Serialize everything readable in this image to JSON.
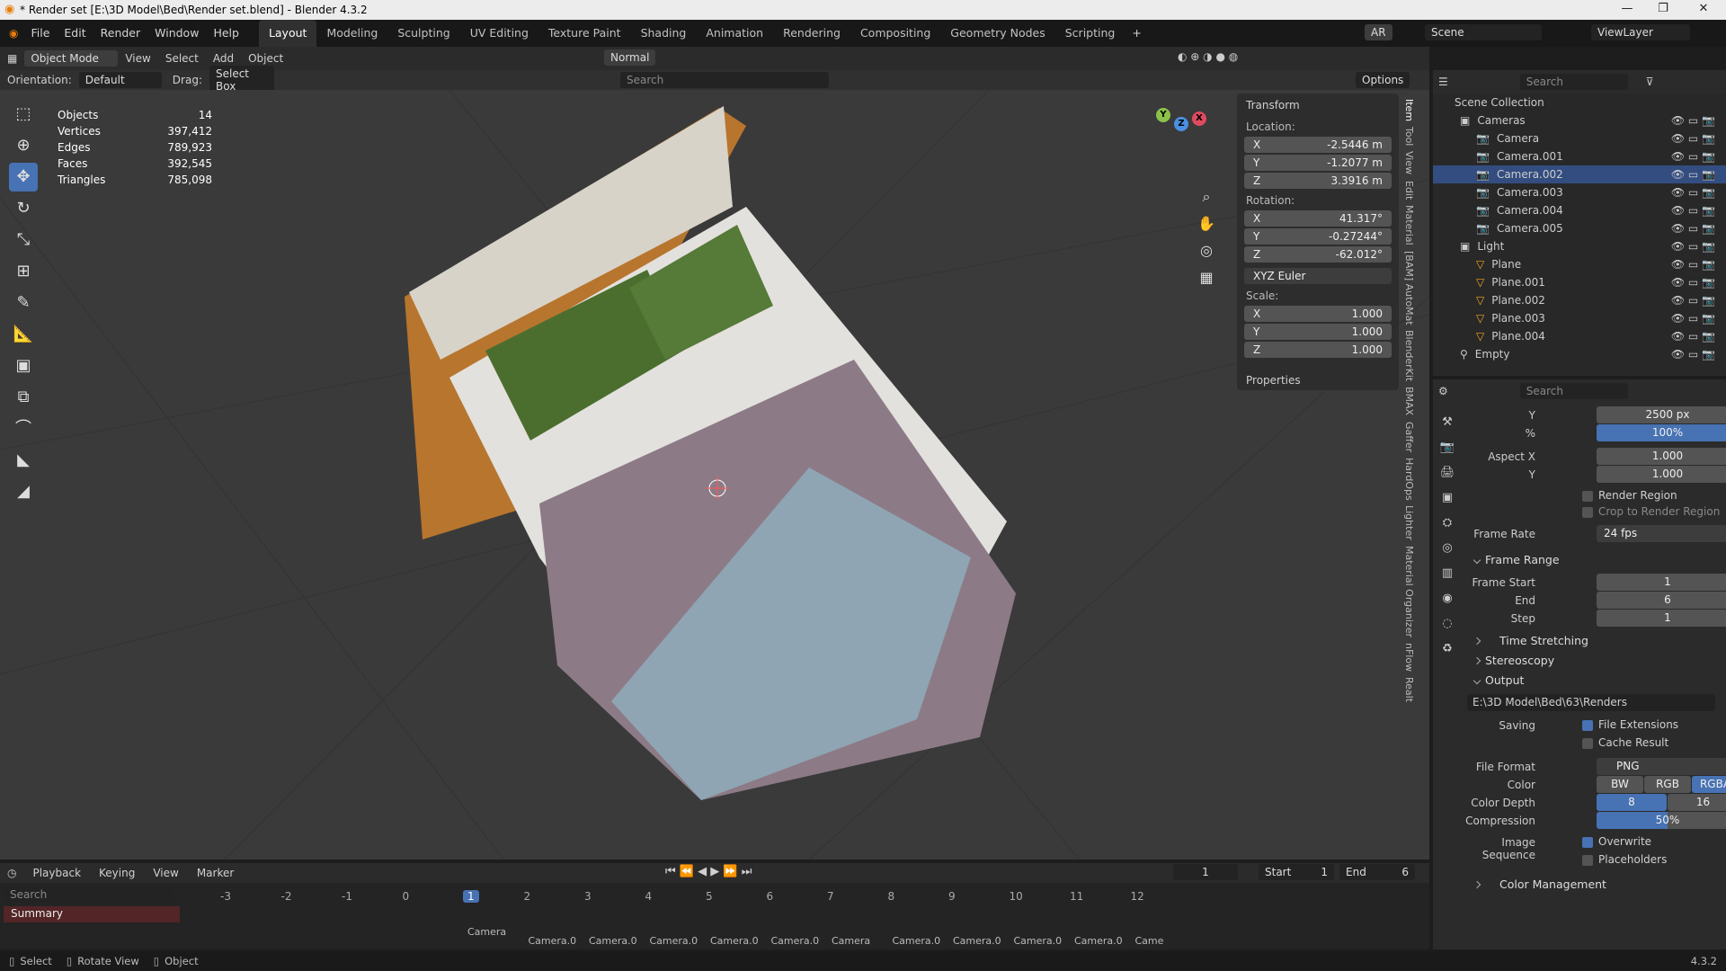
{
  "window": {
    "title": "* Render set [E:\\3D Model\\Bed\\Render set.blend] - Blender 4.3.2",
    "version": "4.3.2"
  },
  "menu": [
    "File",
    "Edit",
    "Render",
    "Window",
    "Help"
  ],
  "workspaces": [
    "Layout",
    "Modeling",
    "Sculpting",
    "UV Editing",
    "Texture Paint",
    "Shading",
    "Animation",
    "Rendering",
    "Compositing",
    "Geometry Nodes",
    "Scripting"
  ],
  "top_right": {
    "ar": "AR",
    "scene": "Scene",
    "view_layer": "ViewLayer"
  },
  "viewport_header": {
    "mode": "Object Mode",
    "menus": [
      "View",
      "Select",
      "Add",
      "Object"
    ],
    "orientation_transform": "Normal",
    "orientation_label": "Orientation:",
    "orientation_value": "Default",
    "drag_label": "Drag:",
    "drag_value": "Select Box",
    "search_placeholder": "Search",
    "options": "Options"
  },
  "stats": [
    {
      "k": "Objects",
      "v": "14"
    },
    {
      "k": "Vertices",
      "v": "397,412"
    },
    {
      "k": "Edges",
      "v": "789,923"
    },
    {
      "k": "Faces",
      "v": "392,545"
    },
    {
      "k": "Triangles",
      "v": "785,098"
    }
  ],
  "transform": {
    "title": "Transform",
    "location_label": "Location:",
    "location": {
      "x": "-2.5446 m",
      "y": "-1.2077 m",
      "z": "3.3916 m"
    },
    "rotation_label": "Rotation:",
    "rotation": {
      "x": "41.317°",
      "y": "-0.27244°",
      "z": "-62.012°"
    },
    "rotation_mode": "XYZ Euler",
    "scale_label": "Scale:",
    "scale": {
      "x": "1.000",
      "y": "1.000",
      "z": "1.000"
    },
    "properties": "Properties"
  },
  "sidebar_tabs": [
    "Item",
    "Tool",
    "View",
    "Edit",
    "Material",
    "[BAM] AutoMat",
    "BlenderKit",
    "BMAX",
    "Gaffer",
    "HardOps",
    "Lighter",
    "Material Organizer",
    "nFlow",
    "Realt"
  ],
  "outliner": {
    "search_placeholder": "Search",
    "root": "Scene Collection",
    "items": [
      {
        "name": "Cameras",
        "indent": 1,
        "type": "collection"
      },
      {
        "name": "Camera",
        "indent": 2,
        "type": "camera"
      },
      {
        "name": "Camera.001",
        "indent": 2,
        "type": "camera"
      },
      {
        "name": "Camera.002",
        "indent": 2,
        "type": "camera",
        "selected": true
      },
      {
        "name": "Camera.003",
        "indent": 2,
        "type": "camera"
      },
      {
        "name": "Camera.004",
        "indent": 2,
        "type": "camera"
      },
      {
        "name": "Camera.005",
        "indent": 2,
        "type": "camera"
      },
      {
        "name": "Light",
        "indent": 1,
        "type": "collection"
      },
      {
        "name": "Plane",
        "indent": 2,
        "type": "mesh"
      },
      {
        "name": "Plane.001",
        "indent": 2,
        "type": "mesh"
      },
      {
        "name": "Plane.002",
        "indent": 2,
        "type": "mesh"
      },
      {
        "name": "Plane.003",
        "indent": 2,
        "type": "mesh"
      },
      {
        "name": "Plane.004",
        "indent": 2,
        "type": "mesh"
      },
      {
        "name": "Empty",
        "indent": 1,
        "type": "empty"
      }
    ]
  },
  "properties": {
    "search_placeholder": "Search",
    "res_y_label": "Y",
    "res_y": "2500 px",
    "pct_label": "%",
    "pct": "100%",
    "aspect_x_label": "Aspect X",
    "aspect_x": "1.000",
    "aspect_y_label": "Y",
    "aspect_y": "1.000",
    "render_region": "Render Region",
    "crop": "Crop to Render Region",
    "frame_rate_label": "Frame Rate",
    "frame_rate": "24 fps",
    "frame_range": "Frame Range",
    "frame_start_label": "Frame Start",
    "frame_start": "1",
    "end_label": "End",
    "end": "6",
    "step_label": "Step",
    "step": "1",
    "time_stretching": "Time Stretching",
    "stereoscopy": "Stereoscopy",
    "output": "Output",
    "output_path": "E:\\3D Model\\Bed\\63\\Renders",
    "saving_label": "Saving",
    "file_extensions": "File Extensions",
    "cache_result": "Cache Result",
    "file_format_label": "File Format",
    "file_format": "PNG",
    "color_label": "Color",
    "color_modes": [
      "BW",
      "RGB",
      "RGBA"
    ],
    "color_depth_label": "Color Depth",
    "depth_8": "8",
    "depth_16": "16",
    "compression_label": "Compression",
    "compression": "50%",
    "image_sequence_label": "Image Sequence",
    "overwrite": "Overwrite",
    "placeholders": "Placeholders",
    "color_management": "Color Management"
  },
  "timeline": {
    "menus": [
      "Playback",
      "Keying",
      "View",
      "Marker"
    ],
    "current_frame": "1",
    "start_label": "Start",
    "start": "1",
    "end_label": "End",
    "end": "6",
    "search_placeholder": "Search",
    "summary": "Summary",
    "ticks": [
      "-3",
      "-2",
      "-1",
      "0",
      "1",
      "2",
      "3",
      "4",
      "5",
      "6",
      "7",
      "8",
      "9",
      "10",
      "11",
      "12"
    ],
    "markers": [
      "Camera",
      "Camera.0",
      "Camera.0",
      "Camera.0",
      "Camera.0",
      "Camera.0",
      "Camera",
      "Camera.0",
      "Camera.0",
      "Camera.0",
      "Camera.0",
      "Came"
    ]
  },
  "statusbar": {
    "select": "Select",
    "rotate": "Rotate View",
    "object": "Object",
    "version": "4.3.2"
  },
  "colors": {
    "accent": "#4772b3",
    "selected_row": "#334d80"
  }
}
